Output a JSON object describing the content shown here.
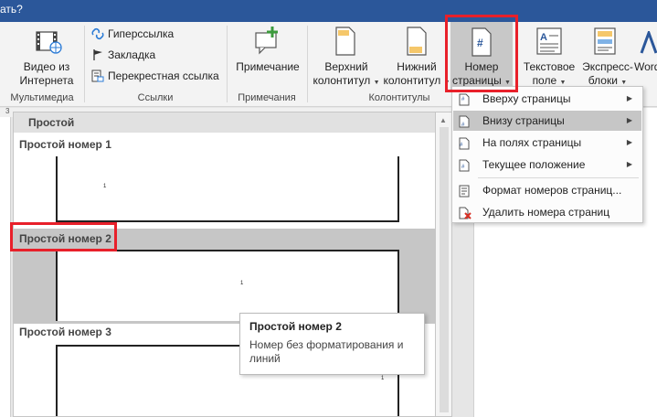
{
  "titlebar": {
    "tell_me": "ать?"
  },
  "ribbon": {
    "ruler_mark": "3",
    "media": {
      "video_label_1": "Видео из",
      "video_label_2": "Интернета",
      "group": "Мультимедиа"
    },
    "links": {
      "items": [
        "Гиперссылка",
        "Закладка",
        "Перекрестная ссылка"
      ],
      "group": "Ссылки"
    },
    "comments": {
      "comment_label": "Примечание",
      "group": "Примечания"
    },
    "header_footer": {
      "header_1": "Верхний",
      "header_2": "колонтитул",
      "footer_1": "Нижний",
      "footer_2": "колонтитул",
      "pagenum_1": "Номер",
      "pagenum_2": "страницы",
      "group": "Колонтитулы"
    },
    "text": {
      "textbox_1": "Текстовое",
      "textbox_2": "поле",
      "quickparts_1": "Экспресс-",
      "quickparts_2": "блоки",
      "wordart": "Word"
    }
  },
  "gallery": {
    "header": "Простой",
    "items": [
      {
        "title": "Простой номер 1",
        "num": "1"
      },
      {
        "title": "Простой номер 2",
        "num": "1"
      },
      {
        "title": "Простой номер 3",
        "num": "1"
      }
    ]
  },
  "menu": {
    "items": [
      {
        "label": "Вверху страницы",
        "submenu": true
      },
      {
        "label": "Внизу страницы",
        "submenu": true
      },
      {
        "label": "На полях страницы",
        "submenu": true
      },
      {
        "label": "Текущее положение",
        "submenu": true
      },
      {
        "label": "Формат номеров страниц...",
        "submenu": false
      },
      {
        "label": "Удалить номера страниц",
        "submenu": false
      }
    ]
  },
  "tooltip": {
    "title": "Простой номер 2",
    "desc": "Номер без форматирования и линий"
  },
  "colors": {
    "accent": "#2b579a",
    "highlight": "#e8202a",
    "hover": "#c6c6c6"
  }
}
